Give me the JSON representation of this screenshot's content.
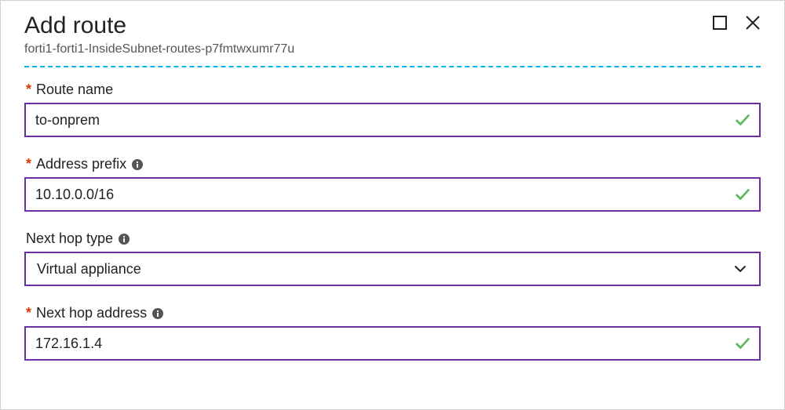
{
  "header": {
    "title": "Add route",
    "breadcrumb": "forti1-forti1-InsideSubnet-routes-p7fmtwxumr77u"
  },
  "fields": {
    "route_name": {
      "label": "Route name",
      "value": "to-onprem",
      "required": true,
      "validated": true,
      "has_info": false
    },
    "address_prefix": {
      "label": "Address prefix",
      "value": "10.10.0.0/16",
      "required": true,
      "validated": true,
      "has_info": true
    },
    "next_hop_type": {
      "label": "Next hop type",
      "value": "Virtual appliance",
      "required": false,
      "has_info": true
    },
    "next_hop_address": {
      "label": "Next hop address",
      "value": "172.16.1.4",
      "required": true,
      "validated": true,
      "has_info": true
    }
  },
  "colors": {
    "accent_border": "#6b2fa0",
    "separator": "#00b6f0",
    "required": "#d83b01",
    "check": "#5cb85c"
  }
}
